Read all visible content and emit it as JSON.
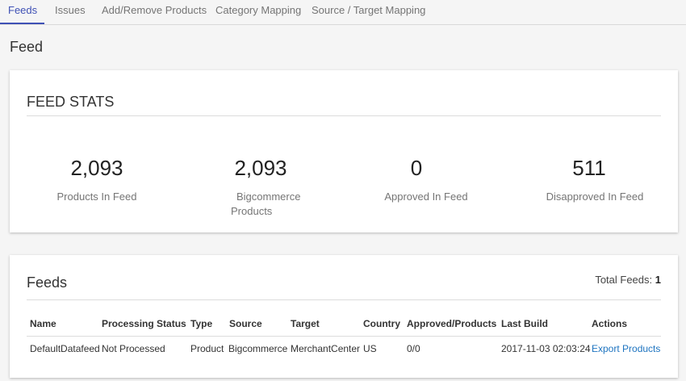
{
  "tabs": [
    {
      "label": "Feeds",
      "active": true
    },
    {
      "label": "Issues"
    },
    {
      "label": "Add/Remove Products"
    },
    {
      "label": "Category Mapping"
    },
    {
      "label": "Source / Target Mapping"
    }
  ],
  "page_title": "Feed",
  "stats": {
    "title": "FEED STATS",
    "items": [
      {
        "value": "2,093",
        "label": "Products In Feed"
      },
      {
        "value": "2,093",
        "label_line1": "Bigcommerce",
        "label_line2": "Products"
      },
      {
        "value": "0",
        "label": "Approved In Feed"
      },
      {
        "value": "511",
        "label": "Disapproved In Feed"
      }
    ]
  },
  "feeds": {
    "title": "Feeds",
    "total_label": "Total Feeds:",
    "total_value": "1",
    "columns": [
      "Name",
      "Processing Status",
      "Type",
      "Source",
      "Target",
      "Country",
      "Approved/Products",
      "Last Build",
      "Actions"
    ],
    "rows": [
      {
        "name": "DefaultDatafeed",
        "processing_status": "Not Processed",
        "type": "Product",
        "source": "Bigcommerce",
        "target": "MerchantCenter",
        "country": "US",
        "approved_products": "0/0",
        "last_build": "2017-11-03 02:03:24",
        "action": "Export Products"
      }
    ]
  },
  "colors": {
    "accent": "#3f51b5",
    "link": "#1e74c0",
    "background": "#f5f5f5"
  }
}
